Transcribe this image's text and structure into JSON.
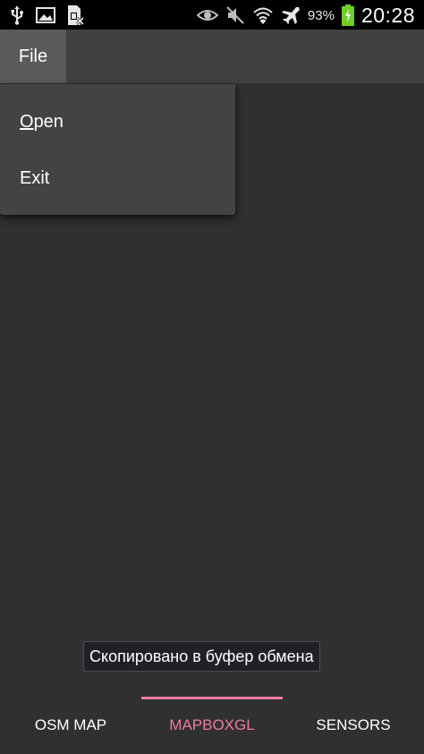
{
  "status_bar": {
    "left_icons": [
      "usb-icon",
      "image-icon",
      "sim-card-icon"
    ],
    "right_icons": [
      "eye-icon",
      "mute-icon",
      "wifi-icon",
      "airplane-icon"
    ],
    "battery_percent": "93%",
    "time": "20:28",
    "battery_color": "#6fcf27"
  },
  "menu": {
    "file_label": "File",
    "items": [
      {
        "mnemonic": "O",
        "rest": "pen"
      },
      {
        "label": "Exit"
      }
    ]
  },
  "toast": {
    "text": "Скопировано в буфер обмена"
  },
  "tabs": {
    "items": [
      {
        "label": "OSM MAP"
      },
      {
        "label": "MAPBOXGL"
      },
      {
        "label": "SENSORS"
      }
    ],
    "selected": "MAPBOXGL",
    "accent_color": "#ee7aa2"
  }
}
